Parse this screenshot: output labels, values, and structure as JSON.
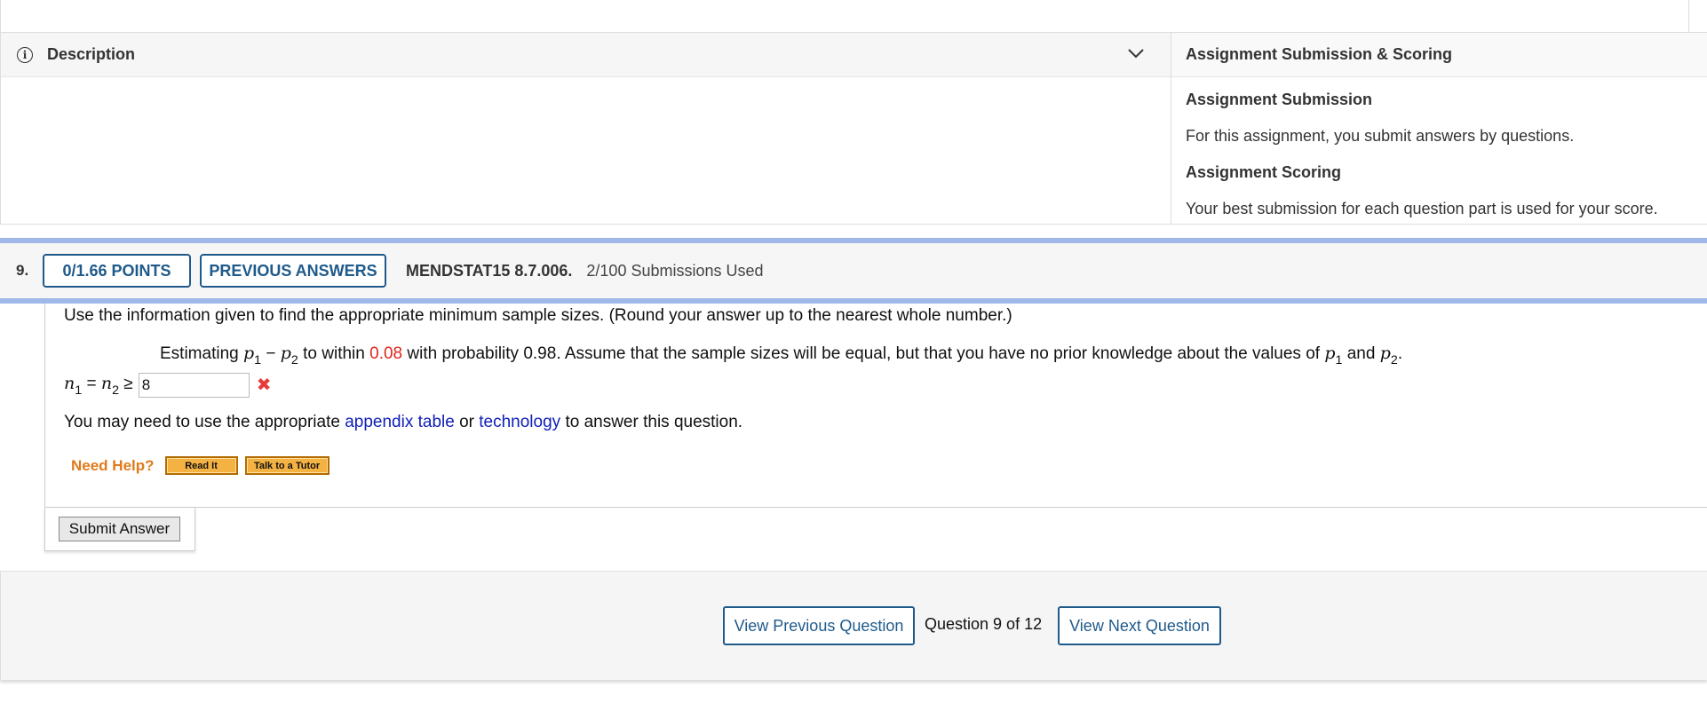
{
  "description": {
    "title": "Description"
  },
  "scoring": {
    "title": "Assignment Submission & Scoring",
    "submission_heading": "Assignment Submission",
    "submission_text": "For this assignment, you submit answers by questions.",
    "scoring_heading": "Assignment Scoring",
    "scoring_text": "Your best submission for each question part is used for your score."
  },
  "question": {
    "number": "9.",
    "points_label": "0/1.66 POINTS",
    "previous_answers_label": "PREVIOUS ANSWERS",
    "code": "MENDSTAT15 8.7.006.",
    "submissions": "2/100 Submissions Used",
    "instruction": "Use the information given to find the appropriate minimum sample sizes. (Round your answer up to the nearest whole number.)",
    "problem": {
      "prefix": "Estimating ",
      "within_text": " to within ",
      "margin": "0.08",
      "rest": " with probability 0.98. Assume that the sample sizes will be equal, but that you have no prior knowledge about the values of ",
      "and_text": " and ",
      "end": "."
    },
    "answer_value": "8",
    "appendix_intro": "You may need to use the appropriate ",
    "appendix_link": "appendix table",
    "or_text": " or ",
    "technology_link": "technology",
    "appendix_outro": " to answer this question.",
    "need_help": "Need Help?",
    "read_it": "Read It",
    "talk_tutor": "Talk to a Tutor",
    "submit_label": "Submit Answer"
  },
  "navigation": {
    "prev_label": "View Previous Question",
    "counter": "Question 9 of 12",
    "next_label": "View Next Question"
  },
  "colors": {
    "accent": "#1f5a8b",
    "incorrect": "#e83b3b",
    "highlight": "#e0271b",
    "link": "#1020b8",
    "help": "#e07a1a"
  }
}
